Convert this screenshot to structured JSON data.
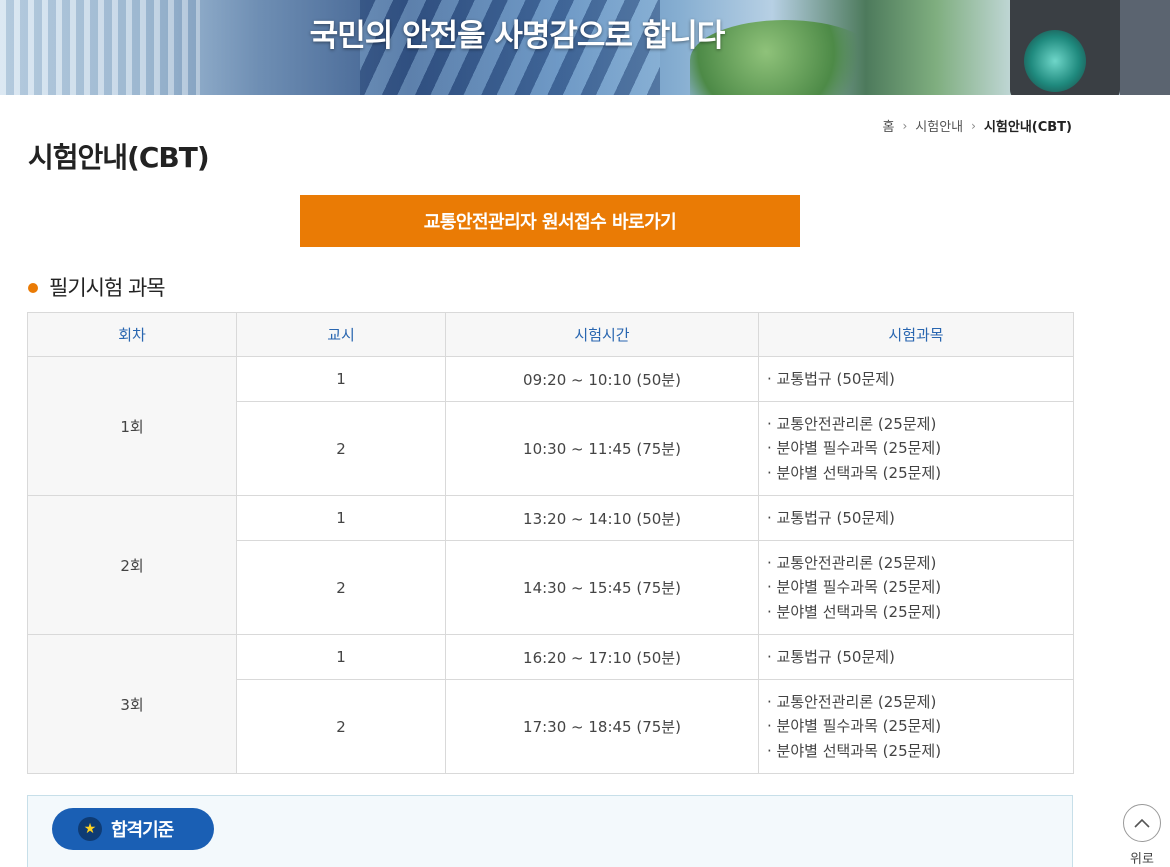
{
  "banner": {
    "slogan": "국민의 안전을 사명감으로 합니다"
  },
  "breadcrumb": {
    "home": "홈",
    "level1": "시험안내",
    "current": "시험안내(CBT)"
  },
  "page": {
    "title": "시험안내(CBT)"
  },
  "apply_button": {
    "label": "교통안전관리자 원서접수 바로가기"
  },
  "section": {
    "title": "필기시험 과목"
  },
  "table": {
    "headers": {
      "round": "회차",
      "period": "교시",
      "time": "시험시간",
      "subjects": "시험과목"
    },
    "rounds": [
      {
        "label": "1회",
        "periods": [
          {
            "period": "1",
            "time": "09:20 ~ 10:10 (50분)",
            "subjects": [
              "· 교통법규 (50문제)"
            ]
          },
          {
            "period": "2",
            "time": "10:30 ~ 11:45 (75분)",
            "subjects": [
              "· 교통안전관리론 (25문제)",
              "· 분야별 필수과목 (25문제)",
              "· 분야별 선택과목 (25문제)"
            ]
          }
        ]
      },
      {
        "label": "2회",
        "periods": [
          {
            "period": "1",
            "time": "13:20 ~ 14:10 (50분)",
            "subjects": [
              "· 교통법규 (50문제)"
            ]
          },
          {
            "period": "2",
            "time": "14:30 ~ 15:45 (75분)",
            "subjects": [
              "· 교통안전관리론 (25문제)",
              "· 분야별 필수과목 (25문제)",
              "· 분야별 선택과목 (25문제)"
            ]
          }
        ]
      },
      {
        "label": "3회",
        "periods": [
          {
            "period": "1",
            "time": "16:20 ~ 17:10 (50분)",
            "subjects": [
              "· 교통법규 (50문제)"
            ]
          },
          {
            "period": "2",
            "time": "17:30 ~ 18:45 (75분)",
            "subjects": [
              "· 교통안전관리론 (25문제)",
              "· 분야별 필수과목 (25문제)",
              "· 분야별 선택과목 (25문제)"
            ]
          }
        ]
      }
    ]
  },
  "criteria": {
    "label": "합격기준",
    "icon": "star-icon"
  },
  "top_button": {
    "label": "위로",
    "icon": "chevron-up-icon"
  },
  "colors": {
    "accent": "#ea7b05",
    "header_text": "#2966b0",
    "badge": "#1a5fb4"
  }
}
